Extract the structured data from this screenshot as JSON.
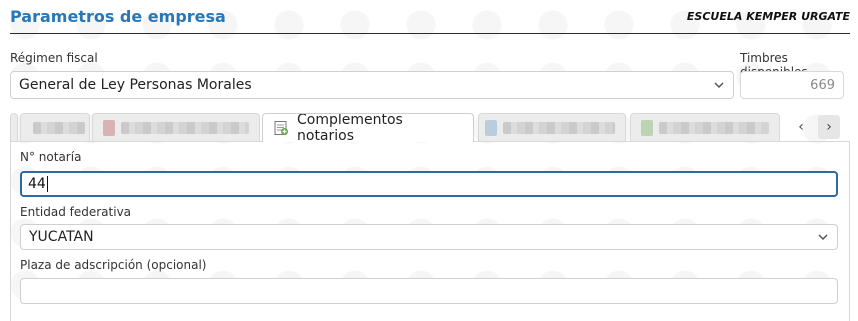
{
  "header": {
    "title": "Parametros de empresa",
    "organization": "ESCUELA KEMPER URGATE"
  },
  "regimen": {
    "label": "Régimen fiscal",
    "value": "General de Ley Personas Morales"
  },
  "timbres": {
    "label": "Timbres disponibles",
    "value": "669"
  },
  "tabs": {
    "active_label": "Complementos notarios",
    "prev_symbol": "‹",
    "next_symbol": "›"
  },
  "form": {
    "notaria_label": "N° notaría",
    "notaria_value": "44",
    "entidad_label": "Entidad federativa",
    "entidad_value": "YUCATAN",
    "plaza_label": "Plaza de adscripción (opcional)",
    "plaza_value": ""
  },
  "colors": {
    "title": "#2878b8",
    "focus_border": "#2c6aa0"
  }
}
